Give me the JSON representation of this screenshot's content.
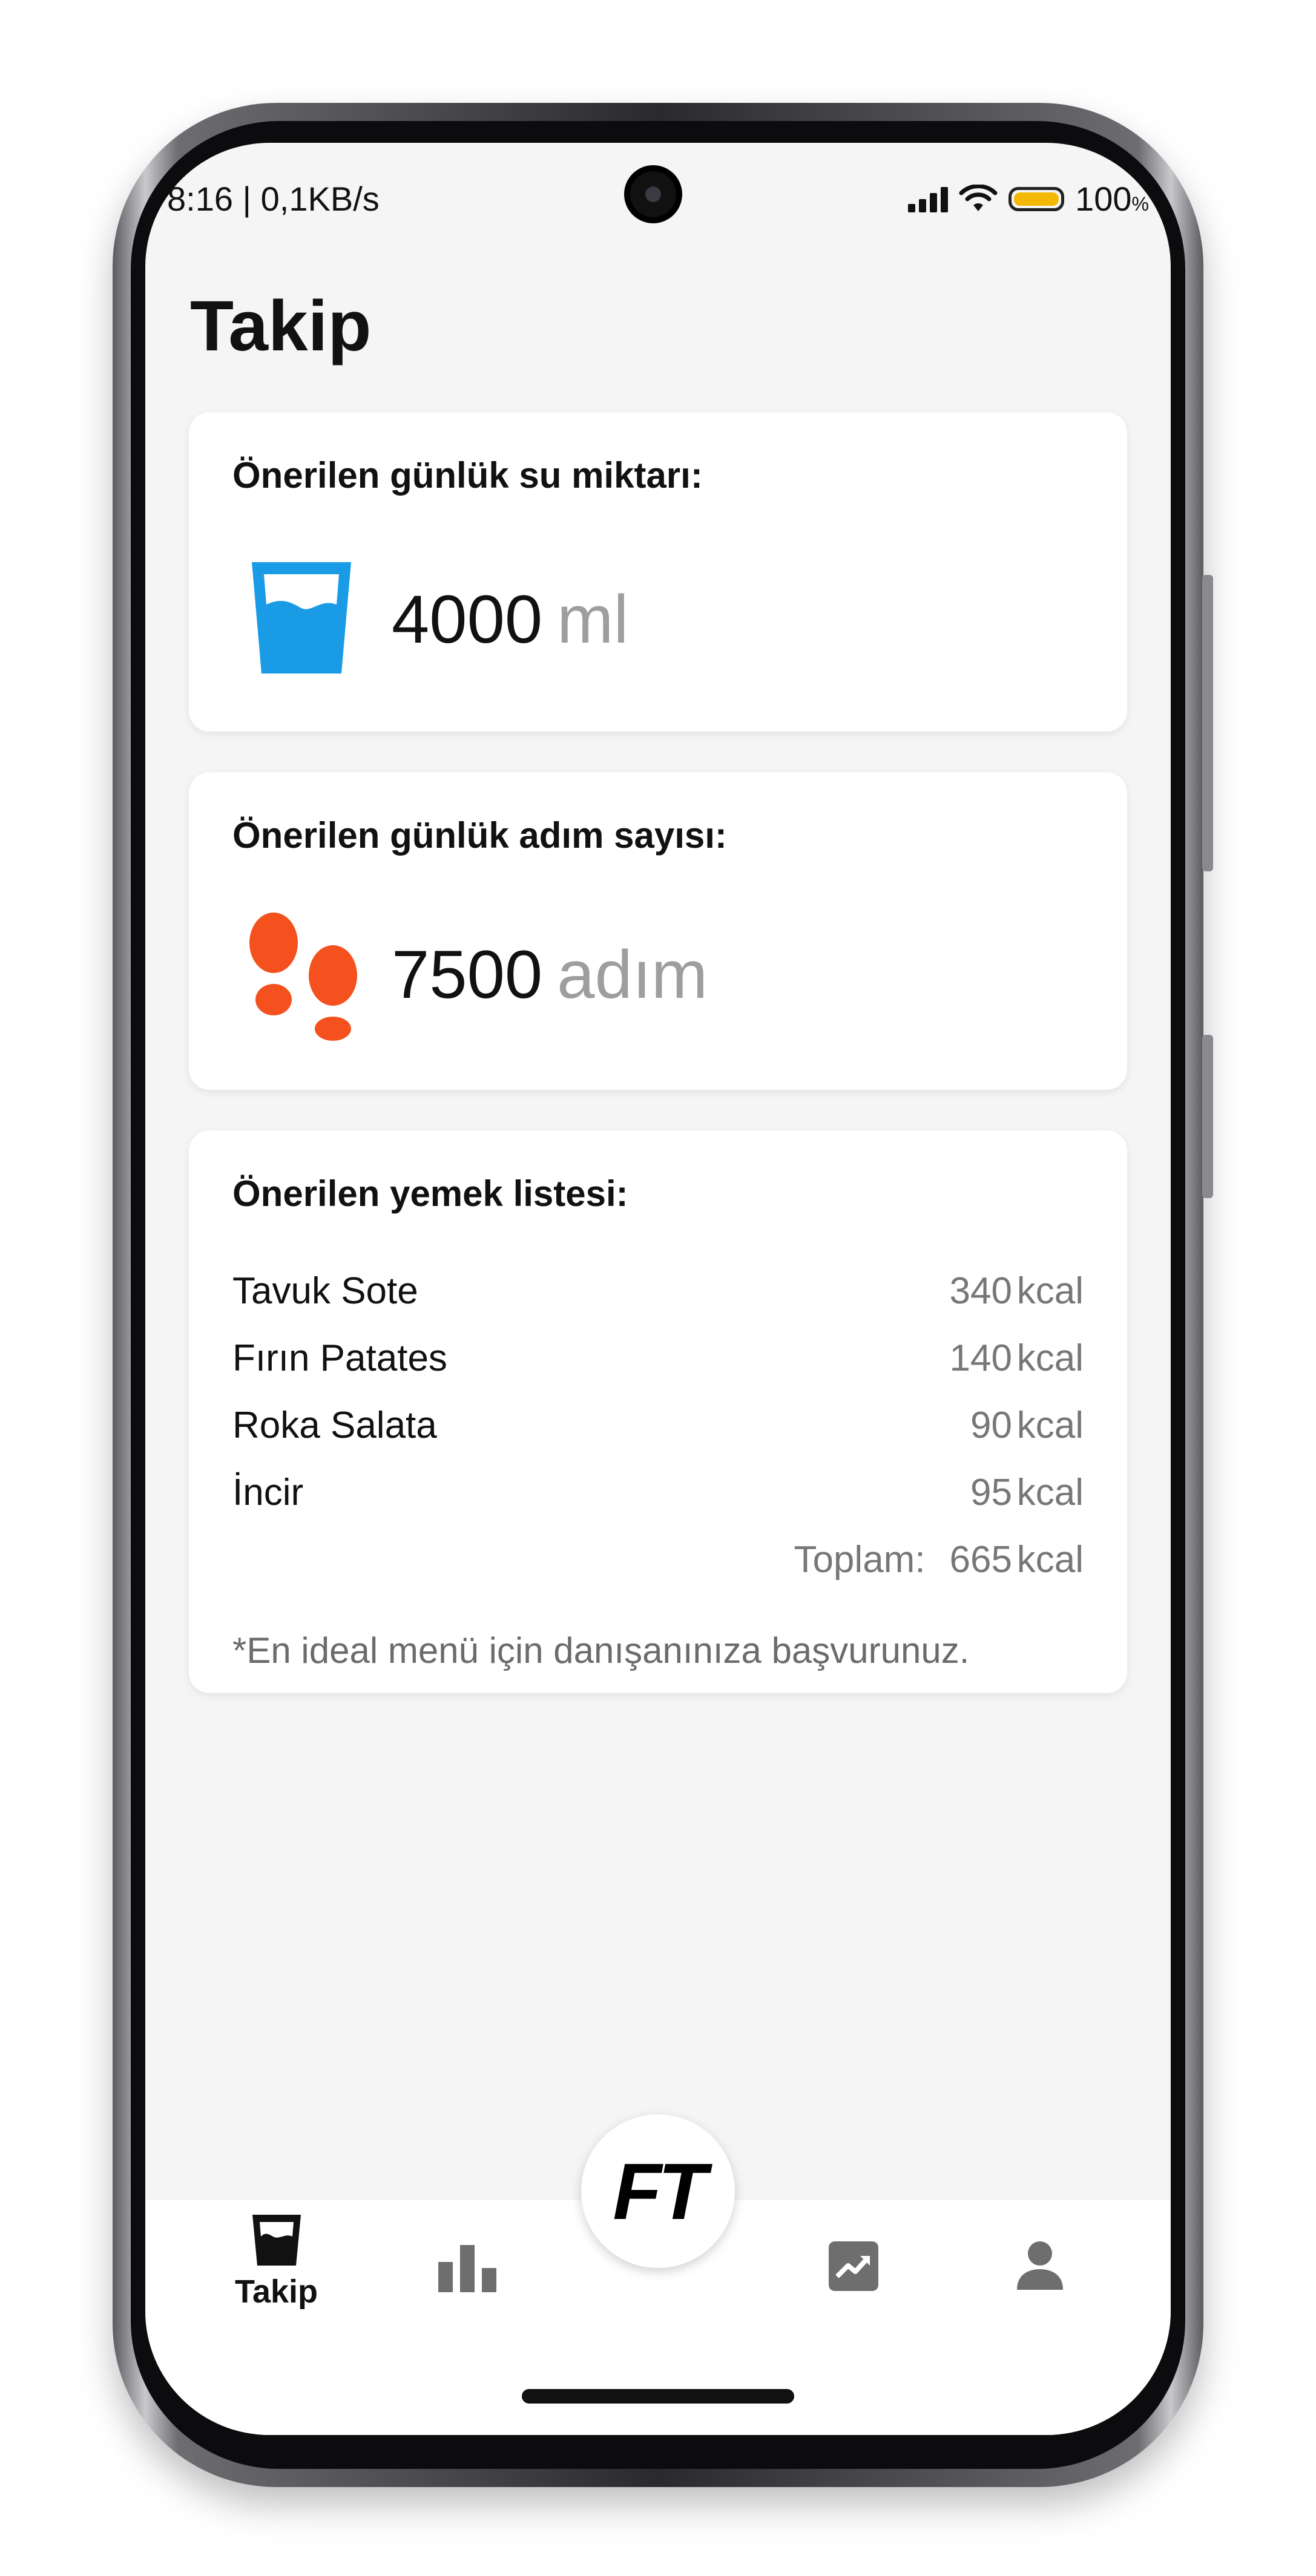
{
  "status_bar": {
    "time_speed": "8:16 | 0,1KB/s",
    "battery": "100",
    "battery_sign": "%"
  },
  "page": {
    "title": "Takip"
  },
  "water_card": {
    "title": "Önerilen günlük su miktarı:",
    "value": "4000",
    "unit": "ml"
  },
  "steps_card": {
    "title": "Önerilen günlük adım sayısı:",
    "value": "7500",
    "unit": "adım"
  },
  "food_card": {
    "title": "Önerilen yemek listesi:",
    "items": [
      {
        "name": "Tavuk Sote",
        "kcal": "340",
        "unit": "kcal"
      },
      {
        "name": "Fırın Patates",
        "kcal": "140",
        "unit": "kcal"
      },
      {
        "name": "Roka Salata",
        "kcal": "90",
        "unit": "kcal"
      },
      {
        "name": "İncir",
        "kcal": "95",
        "unit": "kcal"
      }
    ],
    "total_label": "Toplam:",
    "total_value": "665",
    "total_unit": "kcal",
    "note": "*En ideal menü için danışanınıza başvurunuz."
  },
  "nav": {
    "center_logo": "FT",
    "takip_label": "Takip"
  },
  "colors": {
    "water": "#1a9be6",
    "steps": "#f4511e",
    "background": "#f5f5f5"
  },
  "icons": [
    "water-glass-icon",
    "footprints-icon",
    "bar-chart-icon",
    "trending-up-icon",
    "person-icon"
  ]
}
